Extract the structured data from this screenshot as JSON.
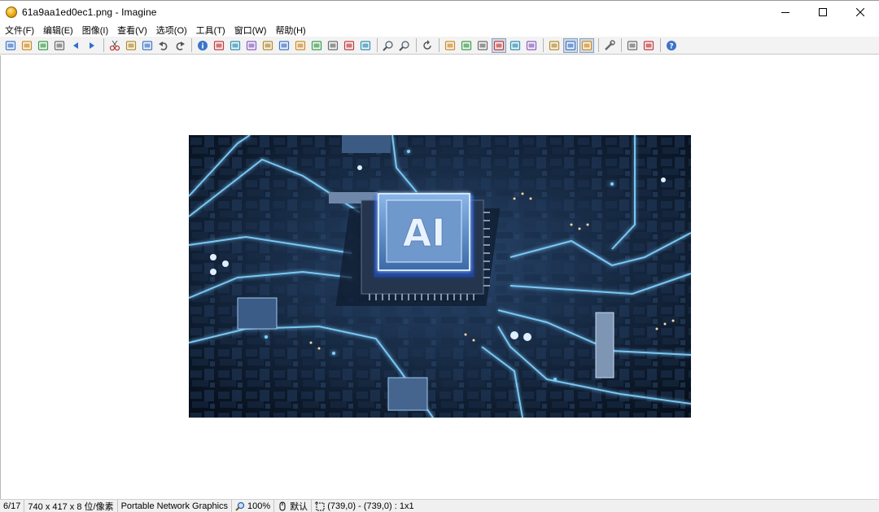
{
  "window": {
    "title": "61a9aa1ed0ec1.png - Imagine"
  },
  "menu": [
    {
      "label": "文件(F)"
    },
    {
      "label": "编辑(E)"
    },
    {
      "label": "图像(I)"
    },
    {
      "label": "查看(V)"
    },
    {
      "label": "选项(O)"
    },
    {
      "label": "工具(T)"
    },
    {
      "label": "窗口(W)"
    },
    {
      "label": "帮助(H)"
    }
  ],
  "toolbar": {
    "groups": [
      [
        "new-icon",
        "open-icon",
        "save-all-icon",
        "print-icon",
        "previous-icon",
        "next-icon"
      ],
      [
        "cut-icon",
        "copy-icon",
        "paste-icon",
        "undo-icon",
        "redo-icon"
      ],
      [
        "info-icon",
        "filmstrip-icon",
        "flip-horizontal-icon",
        "flip-vertical-icon",
        "grayscale-icon",
        "contrast-icon",
        "color-icon",
        "rotate-icon",
        "crop-icon",
        "resize-icon",
        "effects-icon"
      ],
      [
        "zoom-in-icon",
        "zoom-out-icon"
      ],
      [
        "refresh-icon"
      ],
      [
        "brightness-up-icon",
        "brightness-down-icon",
        "sharpen-icon",
        "fit-window-icon",
        "actual-size-icon",
        "full-screen-icon"
      ],
      [
        "slideshow-icon",
        "thumbnail-view-icon",
        "edit-mode-icon"
      ],
      [
        "settings-icon"
      ],
      [
        "batch-convert-icon",
        "capture-icon"
      ],
      [
        "help-icon"
      ]
    ],
    "pressed": [
      "thumbnail-view-icon",
      "edit-mode-icon",
      "fit-window-icon"
    ]
  },
  "image": {
    "overlay_text": "AI"
  },
  "statusbar": {
    "position": "6/17",
    "dimensions": "740 x 417 x 8 位/像素",
    "format": "Portable Network Graphics",
    "zoom": "100%",
    "mode": "默认",
    "selection": "(739,0) - (739,0) : 1x1"
  }
}
